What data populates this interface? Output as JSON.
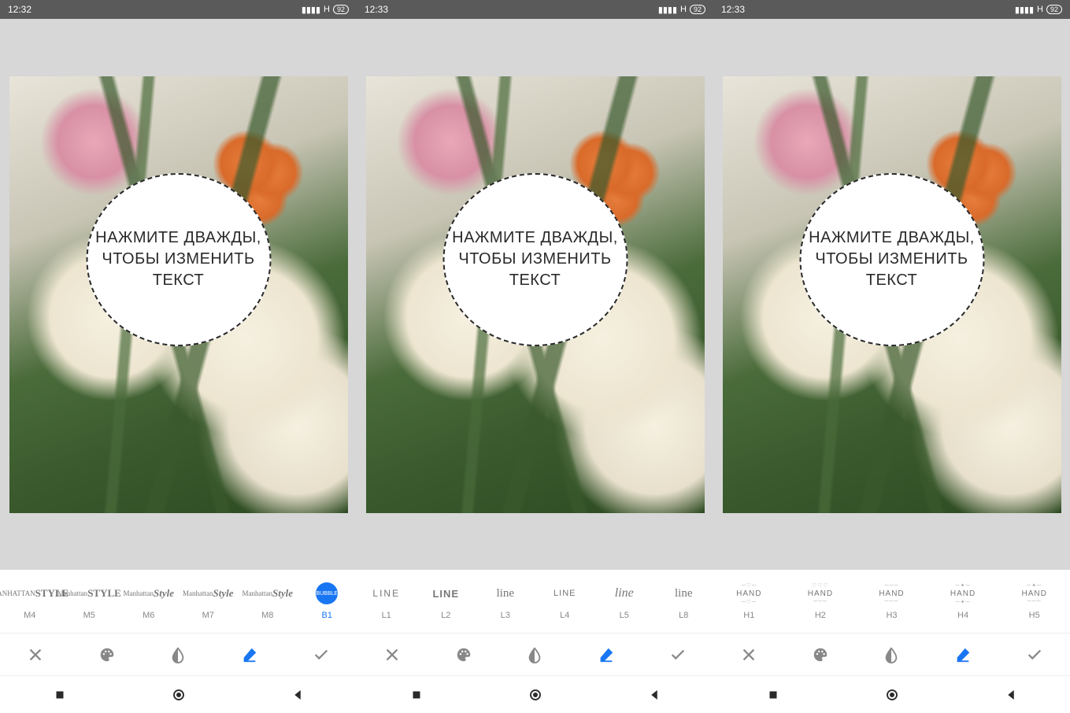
{
  "screens": [
    {
      "status": {
        "time": "12:32",
        "network": "H",
        "battery": "92"
      },
      "bubble_text": "Нажмите дважды,\nчтобы изменить\nтекст",
      "styles": [
        {
          "code": "M4",
          "preview_top": "MANHATTAN",
          "preview_big": "STYLE",
          "cls": "sp-manhattan sp-m4",
          "active": false
        },
        {
          "code": "M5",
          "preview_top": "Manhattan",
          "preview_big": "STYLE",
          "cls": "sp-manhattan sp-m5",
          "active": false
        },
        {
          "code": "M6",
          "preview_top": "Manhattan",
          "preview_big": "Style",
          "cls": "sp-manhattan sp-m6",
          "active": false
        },
        {
          "code": "M7",
          "preview_top": "Manhattan",
          "preview_big": "Style",
          "cls": "sp-manhattan sp-m7",
          "active": false
        },
        {
          "code": "M8",
          "preview_top": "Manhattan",
          "preview_big": "Style",
          "cls": "sp-manhattan sp-m8",
          "active": false
        },
        {
          "code": "B1",
          "preview_label": "BUBBLE",
          "cls": "sp-bubble",
          "active": true
        }
      ]
    },
    {
      "status": {
        "time": "12:33",
        "network": "H",
        "battery": "92"
      },
      "bubble_text": "Нажмите дважды,\nчтобы изменить\nтекст",
      "styles": [
        {
          "code": "L1",
          "preview_label": "LINE",
          "cls": "sp-line1",
          "active": false
        },
        {
          "code": "L2",
          "preview_label": "LINE",
          "cls": "sp-line2",
          "active": false
        },
        {
          "code": "L3",
          "preview_label": "line",
          "cls": "sp-line3",
          "active": false
        },
        {
          "code": "L4",
          "preview_label": "LINE",
          "cls": "sp-line4",
          "active": false
        },
        {
          "code": "L5",
          "preview_label": "line",
          "cls": "sp-line5",
          "active": false
        },
        {
          "code": "L8",
          "preview_label": "line",
          "cls": "sp-line8",
          "active": false
        }
      ]
    },
    {
      "status": {
        "time": "12:33",
        "network": "H",
        "battery": "92"
      },
      "bubble_text": "Нажмите дважды,\nчтобы изменить\nтекст",
      "styles": [
        {
          "code": "H1",
          "preview_label": "HAND",
          "cls": "sp-hand",
          "active": false
        },
        {
          "code": "H2",
          "preview_label": "HAND",
          "cls": "sp-hand",
          "active": false
        },
        {
          "code": "H3",
          "preview_label": "HAND",
          "cls": "sp-hand",
          "active": false
        },
        {
          "code": "H4",
          "preview_label": "HAND",
          "cls": "sp-hand",
          "active": false
        },
        {
          "code": "H5",
          "preview_label": "HAND",
          "cls": "sp-hand",
          "active": false
        }
      ]
    }
  ],
  "toolbar_icons": [
    "close",
    "palette",
    "opacity",
    "eraser",
    "check"
  ],
  "nav_icons": [
    "recent",
    "home",
    "back"
  ],
  "accent_color": "#1976f2"
}
